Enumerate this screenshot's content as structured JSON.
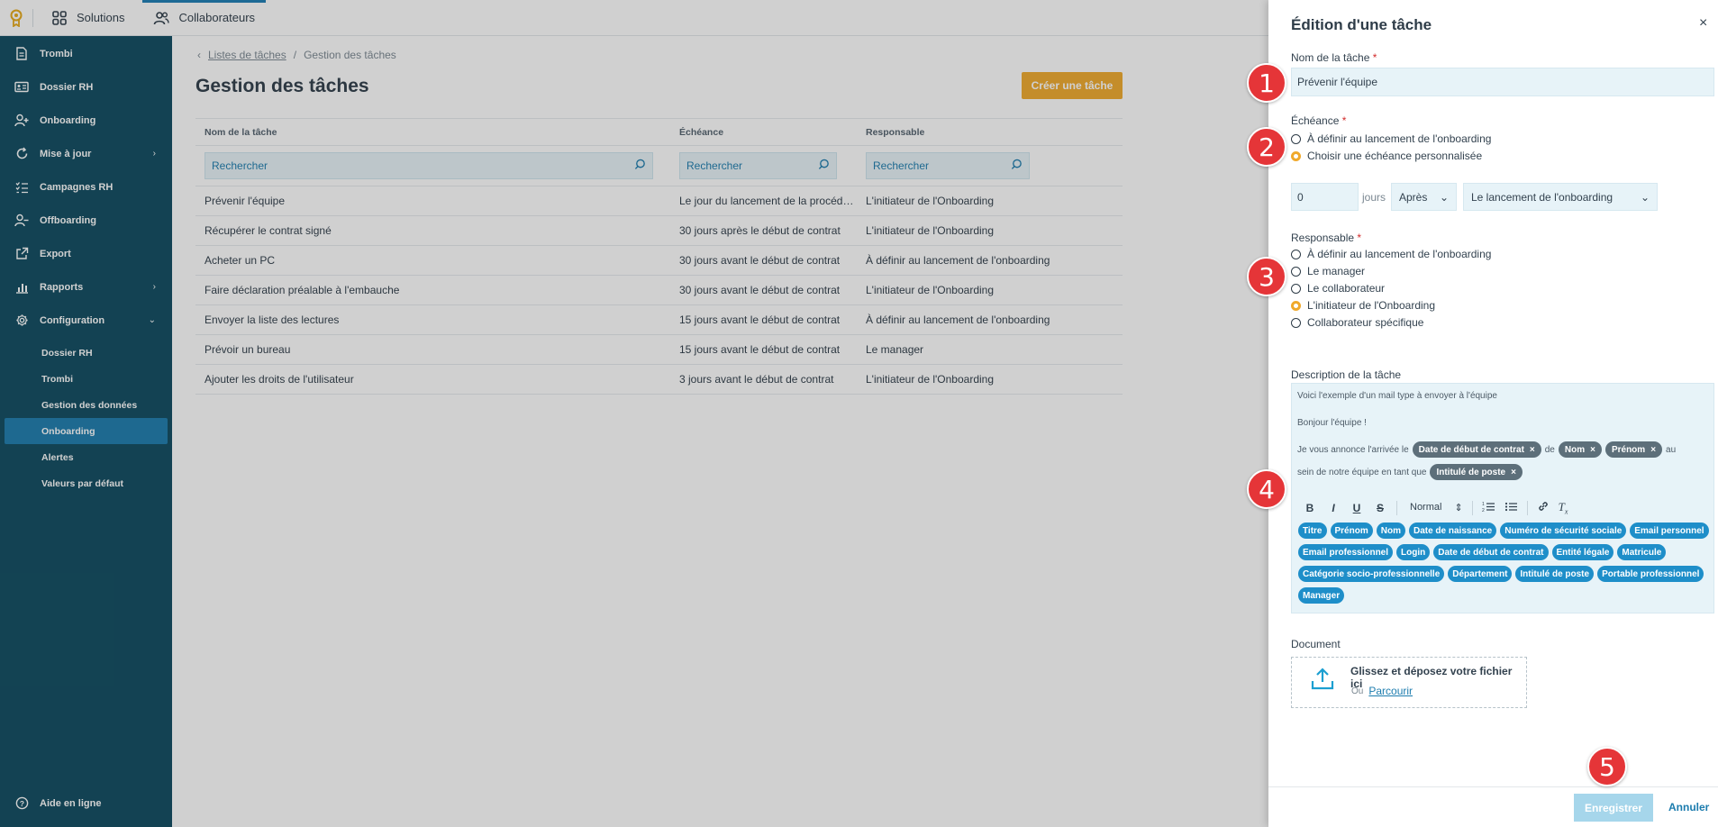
{
  "topbar": {
    "solutions": "Solutions",
    "collaborateurs": "Collaborateurs"
  },
  "sidebar": {
    "items": [
      {
        "label": "Trombi",
        "icon": "document-icon"
      },
      {
        "label": "Dossier RH",
        "icon": "id-card-icon"
      },
      {
        "label": "Onboarding",
        "icon": "user-plus-icon"
      },
      {
        "label": "Mise à jour",
        "icon": "refresh-icon",
        "chevron": "›"
      },
      {
        "label": "Campagnes RH",
        "icon": "checklist-icon"
      },
      {
        "label": "Offboarding",
        "icon": "user-minus-icon"
      },
      {
        "label": "Export",
        "icon": "export-icon"
      },
      {
        "label": "Rapports",
        "icon": "chart-icon",
        "chevron": "›"
      },
      {
        "label": "Configuration",
        "icon": "gear-icon",
        "chevron": "⌄"
      }
    ],
    "subitems": [
      "Dossier RH",
      "Trombi",
      "Gestion des données",
      "Onboarding",
      "Alertes",
      "Valeurs par défaut"
    ],
    "help": "Aide en ligne"
  },
  "main": {
    "breadcrumb_link": "Listes de tâches",
    "breadcrumb_sep": "/",
    "breadcrumb_current": "Gestion des tâches",
    "title": "Gestion des tâches",
    "create_button": "Créer une tâche",
    "columns": [
      "Nom de la tâche",
      "Échéance",
      "Responsable"
    ],
    "search_placeholder": "Rechercher",
    "rows": [
      [
        "Prévenir l'équipe",
        "Le jour du lancement de la procédure",
        "L'initiateur de l'Onboarding"
      ],
      [
        "Récupérer le contrat signé",
        "30 jours après le début de contrat",
        "L'initiateur de l'Onboarding"
      ],
      [
        "Acheter un PC",
        "30 jours avant le début de contrat",
        "À définir au lancement de l'onboarding"
      ],
      [
        "Faire déclaration préalable à l'embauche",
        "30 jours avant le début de contrat",
        "L'initiateur de l'Onboarding"
      ],
      [
        "Envoyer la liste des lectures",
        "15 jours avant le début de contrat",
        "À définir au lancement de l'onboarding"
      ],
      [
        "Prévoir un bureau",
        "15 jours avant le début de contrat",
        "Le manager"
      ],
      [
        "Ajouter les droits de l'utilisateur",
        "3 jours avant le début de contrat",
        "L'initiateur de l'Onboarding"
      ]
    ]
  },
  "panel": {
    "title": "Édition d'une tâche",
    "close": "×",
    "name_label": "Nom de la tâche",
    "name_value": "Prévenir l'équipe",
    "required": "*",
    "echeance_label": "Échéance",
    "echeance_options": [
      "À définir au lancement de l'onboarding",
      "Choisir une échéance personnalisée"
    ],
    "echeance_selected": 1,
    "days_value": "0",
    "days_unit": "jours",
    "direction_value": "Après",
    "reference_value": "Le lancement de l'onboarding",
    "responsable_label": "Responsable",
    "responsable_options": [
      "À définir au lancement de l'onboarding",
      "Le manager",
      "Le collaborateur",
      "L'initiateur de l'Onboarding",
      "Collaborateur spécifique"
    ],
    "responsable_selected": 3,
    "description_label": "Description de la tâche",
    "desc_line1": "Voici l'exemple d'un mail type à envoyer à l'équipe",
    "desc_line2": "Bonjour l'équipe !",
    "desc_line3_start": "Je vous annonce l'arrivée le",
    "desc_chip1": "Date de début de contrat",
    "desc_de": "de",
    "desc_chip2": "Nom",
    "desc_chip3": "Prénom",
    "desc_au": "au",
    "desc_line4_start": "sein de notre équipe en tant que",
    "desc_chip4": "Intitulé de poste",
    "chip_remove": "×",
    "toolbar": {
      "bold": "B",
      "italic": "I",
      "underline": "U",
      "strike": "S",
      "format": "Normal"
    },
    "tags": [
      "Titre",
      "Prénom",
      "Nom",
      "Date de naissance",
      "Numéro de sécurité sociale",
      "Email personnel",
      "Email professionnel",
      "Login",
      "Date de début de contrat",
      "Entité légale",
      "Matricule",
      "Catégorie socio-professionnelle",
      "Département",
      "Intitulé de poste",
      "Portable professionnel",
      "Manager"
    ],
    "document_label": "Document",
    "dropzone_text": "Glissez et déposez votre fichier ici",
    "dropzone_or": "Ou",
    "dropzone_browse": "Parcourir",
    "save": "Enregistrer",
    "cancel": "Annuler"
  },
  "badges": [
    "1",
    "2",
    "3",
    "4",
    "5"
  ],
  "colors": {
    "sidebar": "#0d4a5f",
    "accent": "#f0a92b",
    "link": "#1c7cae",
    "badge": "#e53538"
  }
}
